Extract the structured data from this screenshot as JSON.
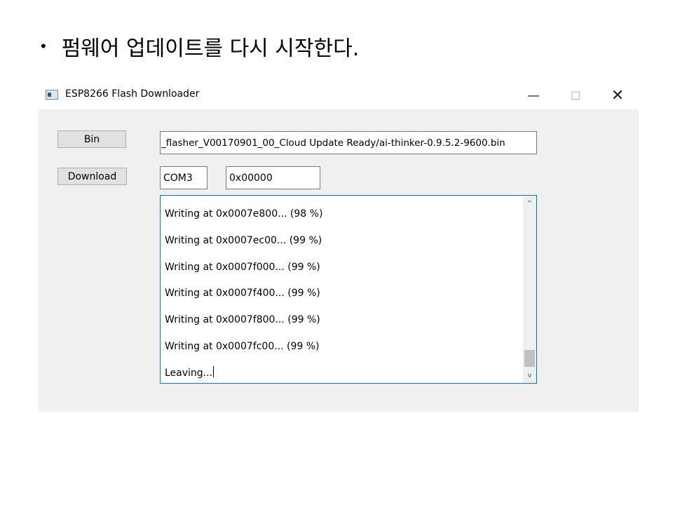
{
  "slide": {
    "bullet_text": "펌웨어 업데이트를 다시 시작한다."
  },
  "window": {
    "title": "ESP8266 Flash Downloader",
    "controls": {
      "minimize": "—",
      "maximize": "☐",
      "close": "✕"
    }
  },
  "form": {
    "bin_label": "Bin",
    "download_label": "Download",
    "bin_path": "_flasher_V00170901_00_Cloud Update Ready/ai-thinker-0.9.5.2-9600.bin",
    "com_port": "COM3",
    "address": "0x00000"
  },
  "log": {
    "lines": [
      "Writing at 0x0007e800... (98 %)",
      "Writing at 0x0007ec00... (99 %)",
      "Writing at 0x0007f000... (99 %)",
      "Writing at 0x0007f400... (99 %)",
      "Writing at 0x0007f800... (99 %)",
      "Writing at 0x0007fc00... (99 %)",
      "Leaving..."
    ],
    "scroll_up": "^",
    "scroll_down": "v"
  }
}
